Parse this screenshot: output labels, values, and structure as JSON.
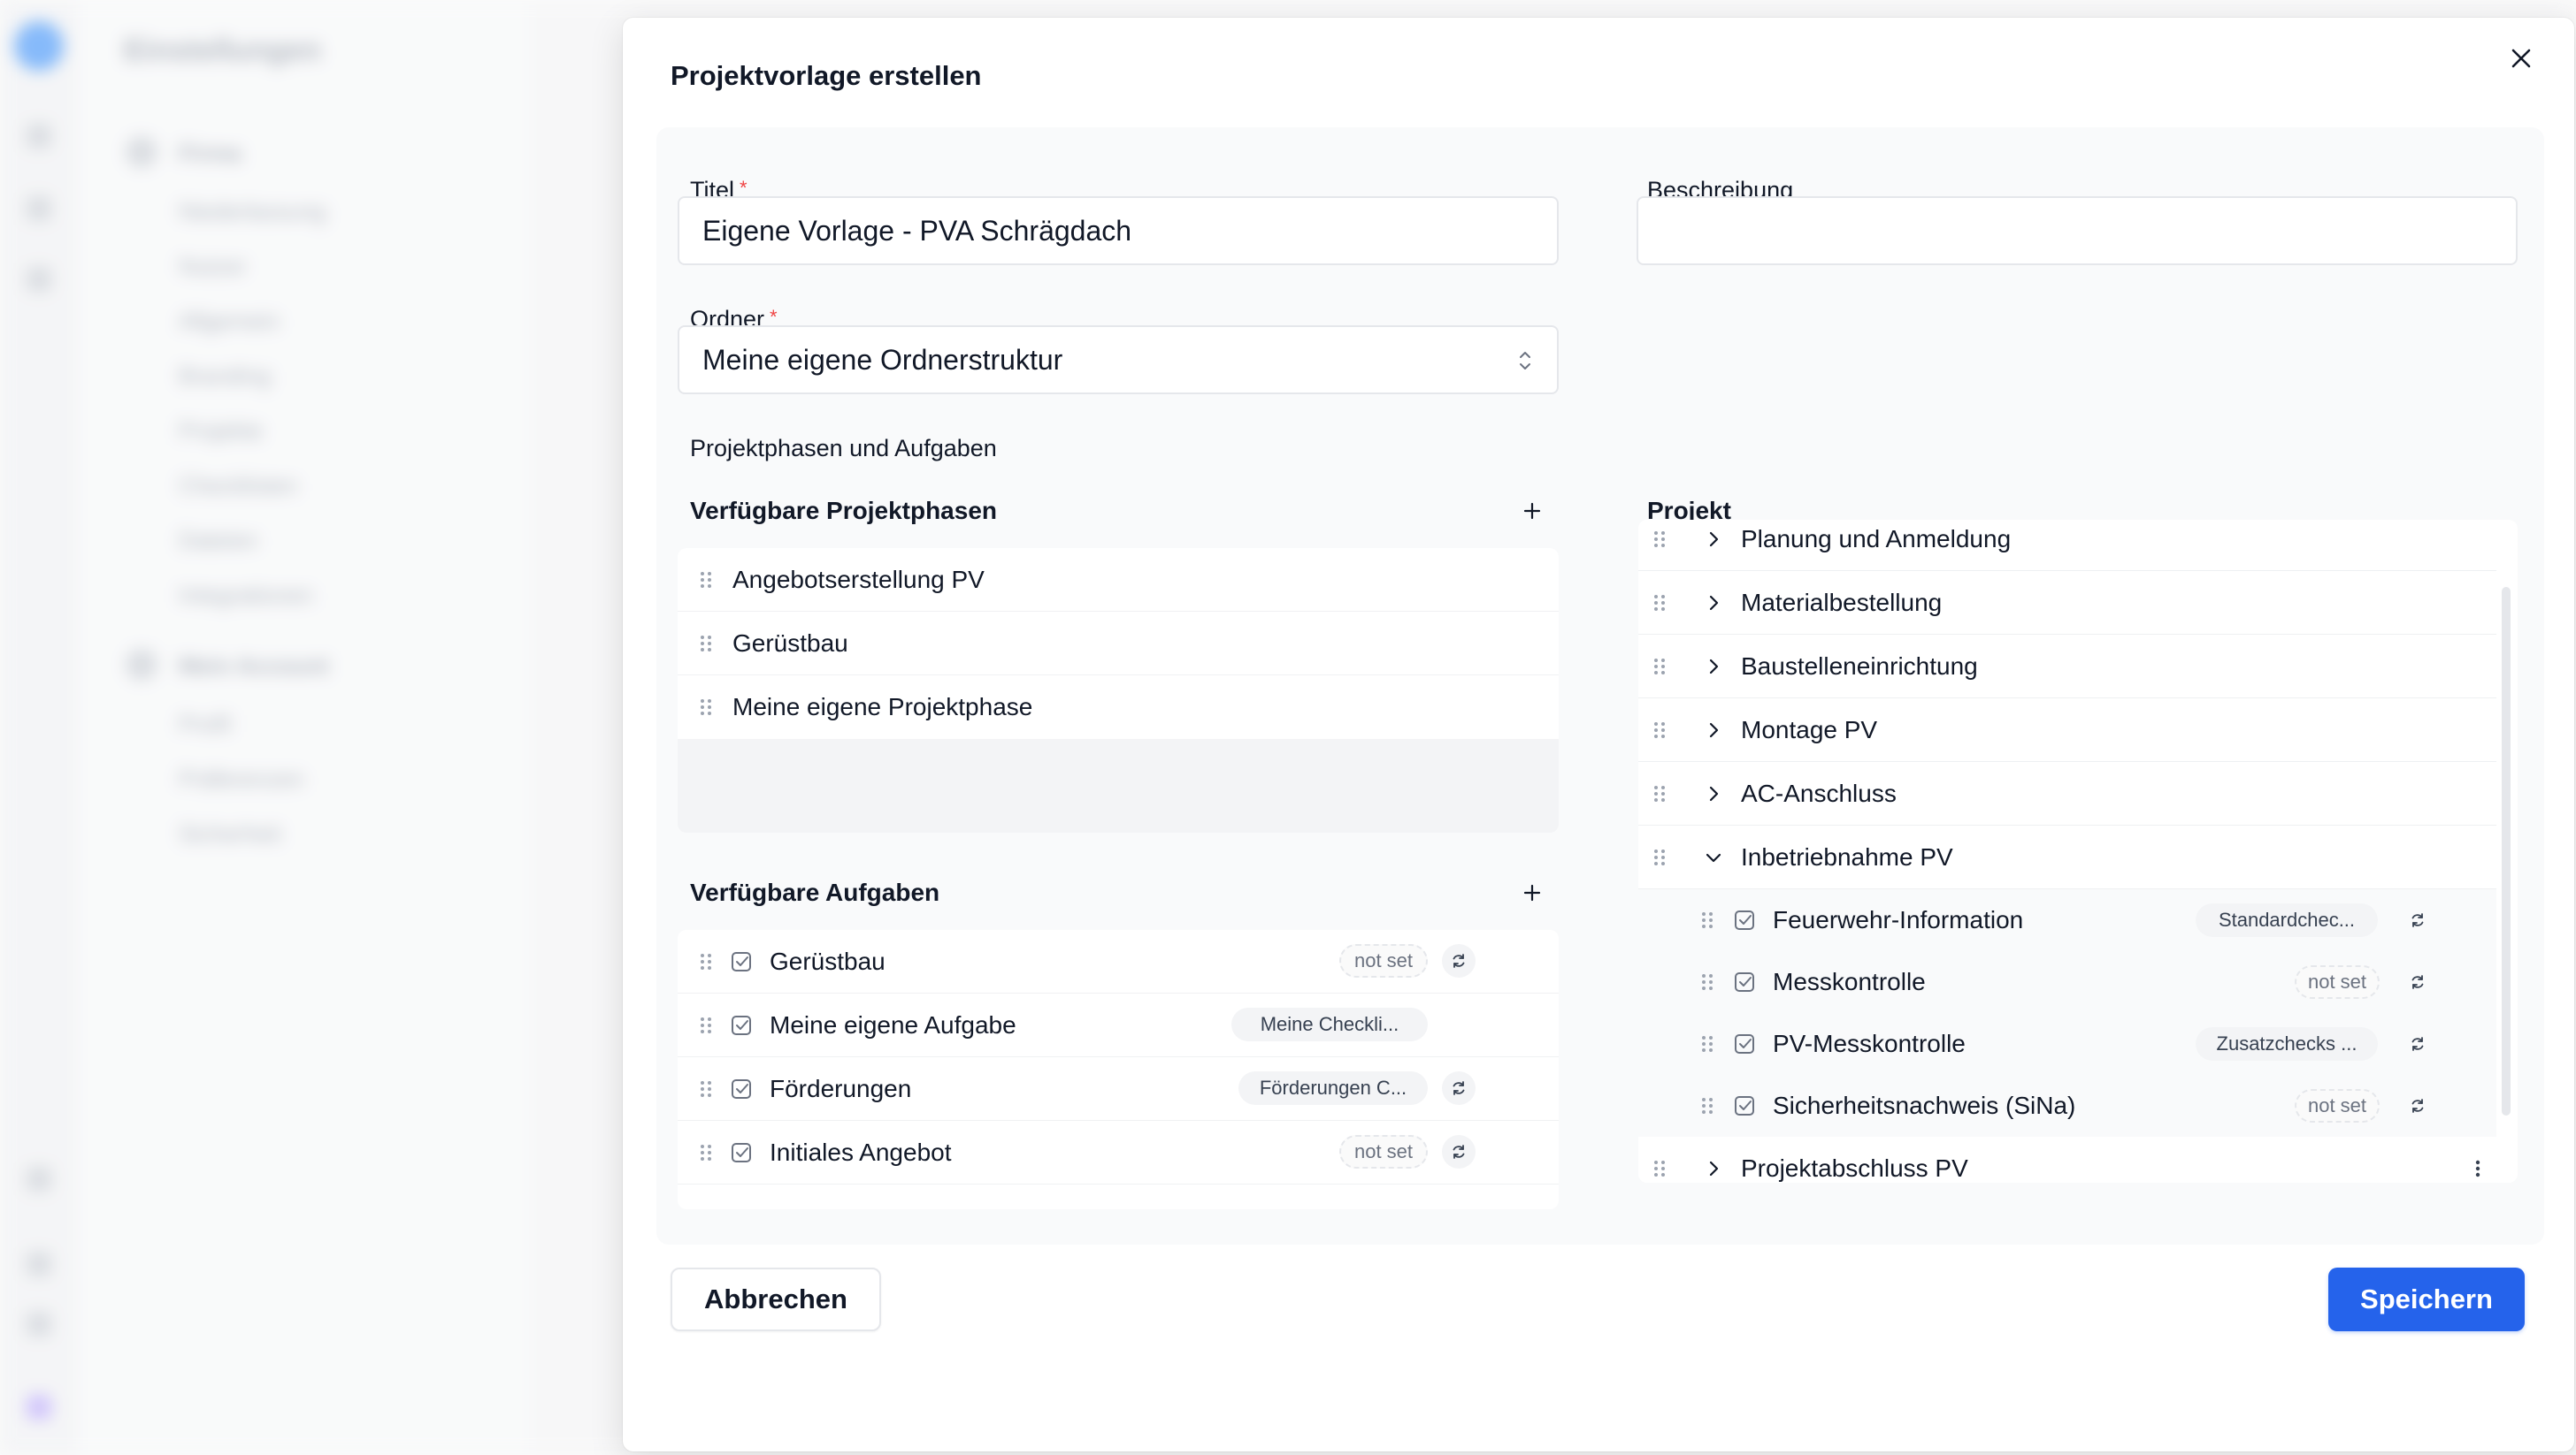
{
  "modal": {
    "title": "Projektvorlage erstellen",
    "close_icon": "close-icon"
  },
  "form": {
    "title_label": "Titel",
    "title_value": "Eigene Vorlage - PVA Schrägdach",
    "required_mark": "*",
    "description_label": "Beschreibung",
    "description_value": "",
    "folder_label": "Ordner",
    "folder_value": "Meine eigene Ordnerstruktur",
    "phases_tasks_label": "Projektphasen und Aufgaben"
  },
  "available_phases": {
    "heading": "Verfügbare Projektphasen",
    "items": [
      {
        "label": "Angebotserstellung PV"
      },
      {
        "label": "Gerüstbau"
      },
      {
        "label": "Meine eigene Projektphase"
      }
    ]
  },
  "available_tasks": {
    "heading": "Verfügbare Aufgaben",
    "items": [
      {
        "label": "Gerüstbau",
        "checklist": "not set",
        "checklist_set": false
      },
      {
        "label": "Meine eigene Aufgabe",
        "checklist": "Meine Checkli...",
        "checklist_set": true
      },
      {
        "label": "Förderungen",
        "checklist": "Förderungen C...",
        "checklist_set": true
      },
      {
        "label": "Initiales Angebot",
        "checklist": "not set",
        "checklist_set": false
      }
    ]
  },
  "project": {
    "heading": "Projekt",
    "phases": [
      {
        "label": "Planung und Anmeldung",
        "expanded": false
      },
      {
        "label": "Materialbestellung",
        "expanded": false
      },
      {
        "label": "Baustelleneinrichtung",
        "expanded": false
      },
      {
        "label": "Montage PV",
        "expanded": false
      },
      {
        "label": "AC-Anschluss",
        "expanded": false
      },
      {
        "label": "Inbetriebnahme PV",
        "expanded": true
      }
    ],
    "children": [
      {
        "label": "Feuerwehr-Information",
        "checklist": "Standardchec...",
        "checklist_set": true
      },
      {
        "label": "Messkontrolle",
        "checklist": "not set",
        "checklist_set": false
      },
      {
        "label": "PV-Messkontrolle",
        "checklist": "Zusatzchecks ...",
        "checklist_set": true
      },
      {
        "label": "Sicherheitsnachweis (SiNa)",
        "checklist": "not set",
        "checklist_set": false
      }
    ],
    "last_phase": {
      "label": "Projektabschluss PV",
      "expanded": false
    }
  },
  "footer": {
    "cancel_label": "Abbrechen",
    "save_label": "Speichern"
  },
  "colors": {
    "accent": "#2563eb",
    "required": "#ef4444",
    "panel_bg": "#f9fafb"
  },
  "background": {
    "title": "Einstellungen",
    "nav_company": "Firma",
    "nav_company_items": [
      "Niederlassung",
      "Nutzer",
      "Allgemein",
      "Branding",
      "Projekte",
      "Checklisten",
      "Dateien",
      "Integrationen"
    ],
    "nav_account": "Mein Account",
    "nav_account_items": [
      "Profil",
      "Präferenzen",
      "Sicherheit"
    ]
  }
}
